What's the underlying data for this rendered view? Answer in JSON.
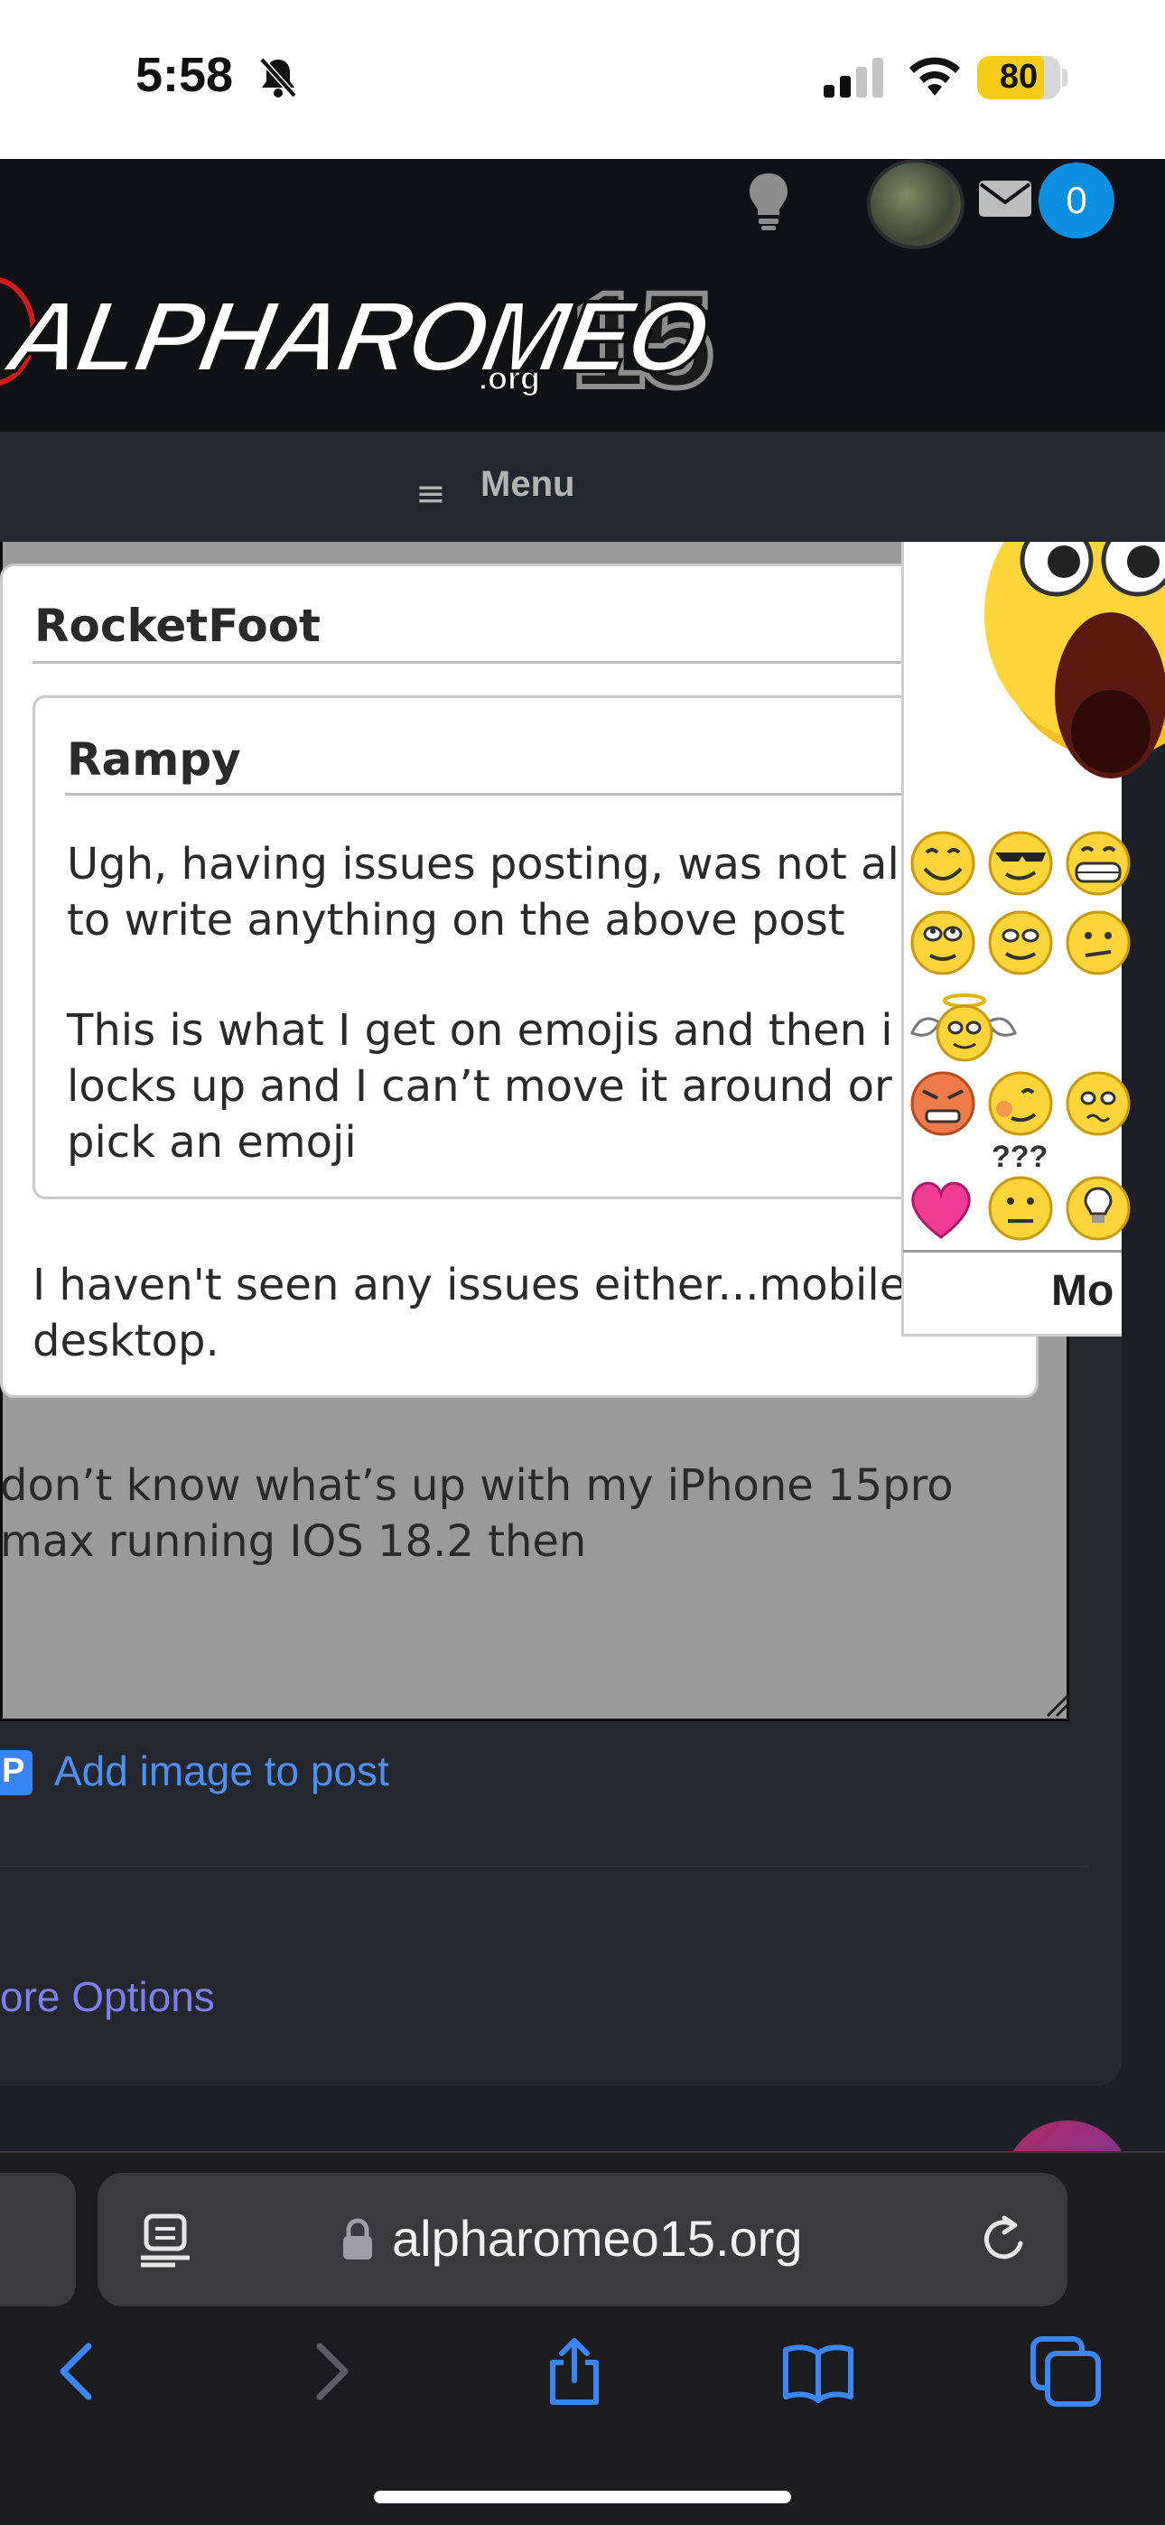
{
  "status_bar": {
    "time": "5:58",
    "battery": "80",
    "battery_level": 0.8,
    "accent_color": "#f6cc1a"
  },
  "header": {
    "mail_count": "0",
    "logo_text": "ALPHAROMEO",
    "logo_number": "15",
    "logo_suffix": ".org",
    "icons": [
      "lightbulb-icon",
      "avatar",
      "mail-icon"
    ]
  },
  "menu": {
    "icon": "hamburger-icon",
    "label": "Menu"
  },
  "post": {
    "outer_quote": {
      "author": "RocketFoot",
      "reply": [
        "I haven't seen any issues either...mobile",
        "desktop."
      ]
    },
    "inner_quote": {
      "author": "Rampy",
      "paragraph1": [
        "Ugh, having issues posting, was not al",
        "to write anything on the above post"
      ],
      "paragraph2": [
        "This is what I get on emojis and then i",
        "locks up and I can’t move it around or",
        "pick an emoji"
      ]
    },
    "draft": [
      "don’t know what’s up with my iPhone 15pro",
      "max running IOS 18.2 then"
    ]
  },
  "actions": {
    "add_image": "Add image to post",
    "more_options": "ore Options",
    "link_color": "#4d8ff2"
  },
  "emoji_popup": {
    "qqq": "???",
    "more": "Mo",
    "emojis": [
      "shocked-emoji",
      "smile-emoji",
      "cool-emoji",
      "grin-emoji",
      "roll-eyes-emoji",
      "wink-emoji",
      "confused-emoji",
      "angel-emoji",
      "angry-emoji",
      "blush-emoji",
      "worried-emoji",
      "heart-emoji",
      "huh-emoji",
      "idea-emoji"
    ]
  },
  "browser": {
    "url": "alpharomeo15.org",
    "icons": [
      "reader-icon",
      "lock-icon",
      "reload-icon",
      "back-icon",
      "forward-icon",
      "share-icon",
      "bookmarks-icon",
      "tabs-icon"
    ]
  }
}
